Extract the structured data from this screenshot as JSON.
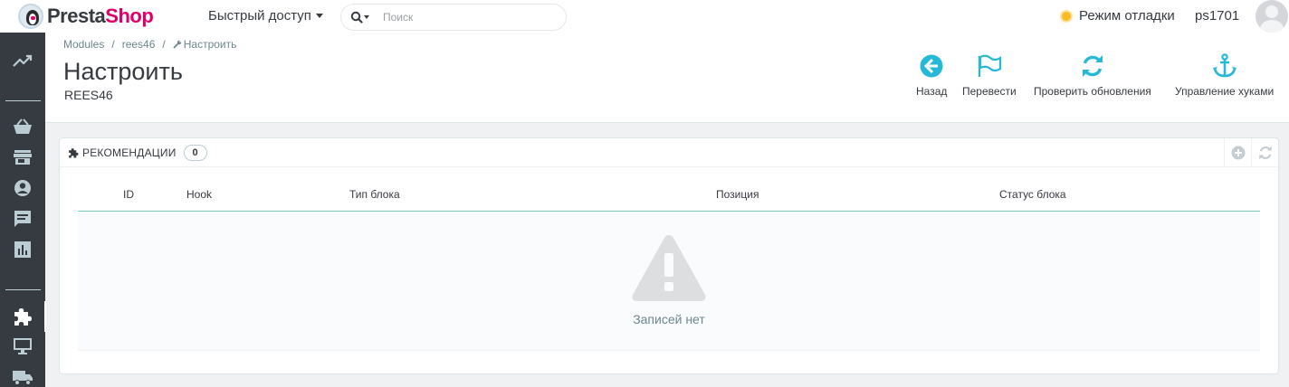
{
  "header": {
    "logo": {
      "part1": "Presta",
      "part2": "Shop"
    },
    "quick_access": "Быстрый доступ",
    "search_placeholder": "Поиск",
    "debug_mode": "Режим отладки",
    "username": "ps1701"
  },
  "sidebar": {
    "icons": [
      "trending-up-icon",
      "basket-icon",
      "store-icon",
      "user-circle-icon",
      "comment-icon",
      "bar-chart-icon",
      "puzzle-icon",
      "monitor-icon",
      "truck-icon"
    ],
    "active": "puzzle-icon"
  },
  "breadcrumb": [
    "Modules",
    "rees46",
    "Настроить"
  ],
  "page": {
    "title": "Настроить",
    "subtitle": "REES46"
  },
  "toolbar": {
    "back": "Назад",
    "translate": "Перевести",
    "check_updates": "Проверить обновления",
    "manage_hooks": "Управление хуками"
  },
  "panel": {
    "title": "РЕКОМЕНДАЦИИ",
    "count": "0",
    "columns": [
      "ID",
      "Hook",
      "Тип блока",
      "Позиция",
      "Статус блока"
    ],
    "empty_text": "Записей нет"
  },
  "colors": {
    "accent": "#25b9d7",
    "sidebar": "#363a41",
    "brand_pink": "#df0067",
    "debug_dot": "#fbbb22"
  }
}
